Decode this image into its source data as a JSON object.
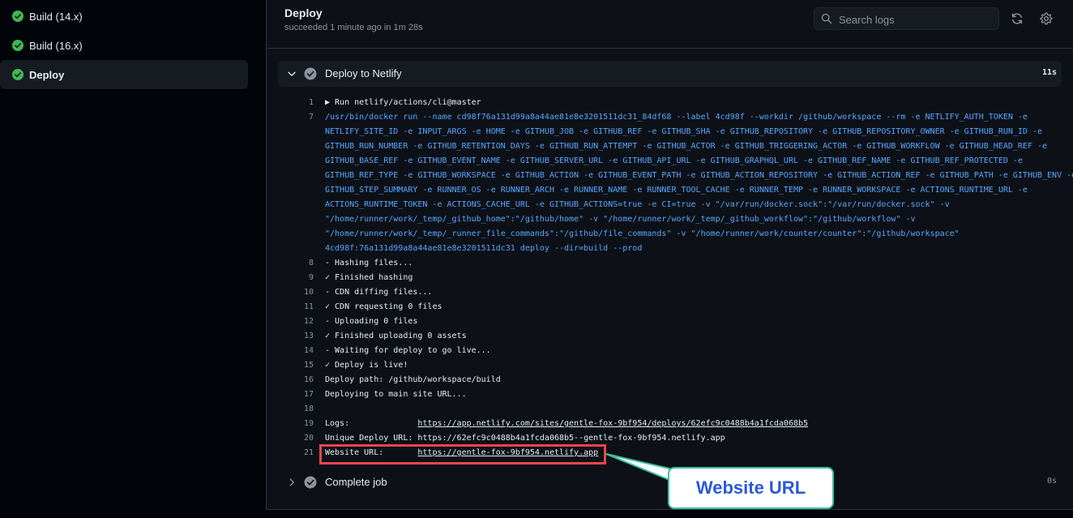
{
  "sidebar": {
    "jobs": [
      {
        "label": "Build (14.x)",
        "status": "success"
      },
      {
        "label": "Build (16.x)",
        "status": "success"
      },
      {
        "label": "Deploy",
        "status": "success",
        "active": true
      }
    ]
  },
  "header": {
    "title": "Deploy",
    "subtitle": "succeeded 1 minute ago in 1m 28s",
    "search_placeholder": "Search logs"
  },
  "steps": {
    "deploy": {
      "label": "Deploy to Netlify",
      "duration": "11s"
    },
    "complete": {
      "label": "Complete job",
      "duration": "0s"
    }
  },
  "log": [
    {
      "n": "1",
      "t": "▶ Run netlify/actions/cli@master"
    },
    {
      "n": "7",
      "t": "/usr/bin/docker run --name cd98f76a131d99a8a44ae81e8e3201511dc31_84df68 --label 4cd98f --workdir /github/workspace --rm -e NETLIFY_AUTH_TOKEN -e"
    },
    {
      "n": "",
      "t": "NETLIFY_SITE_ID -e INPUT_ARGS -e HOME -e GITHUB_JOB -e GITHUB_REF -e GITHUB_SHA -e GITHUB_REPOSITORY -e GITHUB_REPOSITORY_OWNER -e GITHUB_RUN_ID -e"
    },
    {
      "n": "",
      "t": "GITHUB_RUN_NUMBER -e GITHUB_RETENTION_DAYS -e GITHUB_RUN_ATTEMPT -e GITHUB_ACTOR -e GITHUB_TRIGGERING_ACTOR -e GITHUB_WORKFLOW -e GITHUB_HEAD_REF -e"
    },
    {
      "n": "",
      "t": "GITHUB_BASE_REF -e GITHUB_EVENT_NAME -e GITHUB_SERVER_URL -e GITHUB_API_URL -e GITHUB_GRAPHQL_URL -e GITHUB_REF_NAME -e GITHUB_REF_PROTECTED -e"
    },
    {
      "n": "",
      "t": "GITHUB_REF_TYPE -e GITHUB_WORKSPACE -e GITHUB_ACTION -e GITHUB_EVENT_PATH -e GITHUB_ACTION_REPOSITORY -e GITHUB_ACTION_REF -e GITHUB_PATH -e GITHUB_ENV -e"
    },
    {
      "n": "",
      "t": "GITHUB_STEP_SUMMARY -e RUNNER_OS -e RUNNER_ARCH -e RUNNER_NAME -e RUNNER_TOOL_CACHE -e RUNNER_TEMP -e RUNNER_WORKSPACE -e ACTIONS_RUNTIME_URL -e"
    },
    {
      "n": "",
      "t": "ACTIONS_RUNTIME_TOKEN -e ACTIONS_CACHE_URL -e GITHUB_ACTIONS=true -e CI=true -v \"/var/run/docker.sock\":\"/var/run/docker.sock\" -v"
    },
    {
      "n": "",
      "t": "\"/home/runner/work/_temp/_github_home\":\"/github/home\" -v \"/home/runner/work/_temp/_github_workflow\":\"/github/workflow\" -v"
    },
    {
      "n": "",
      "t": "\"/home/runner/work/_temp/_runner_file_commands\":\"/github/file_commands\" -v \"/home/runner/work/counter/counter\":\"/github/workspace\""
    },
    {
      "n": "",
      "t": "4cd98f:76a131d99a8a44ae81e8e3201511dc31 deploy --dir=build --prod"
    },
    {
      "n": "8",
      "t": "- Hashing files..."
    },
    {
      "n": "9",
      "t": "✓ Finished hashing"
    },
    {
      "n": "10",
      "t": "- CDN diffing files..."
    },
    {
      "n": "11",
      "t": "✓ CDN requesting 0 files"
    },
    {
      "n": "12",
      "t": "- Uploading 0 files"
    },
    {
      "n": "13",
      "t": "✓ Finished uploading 0 assets"
    },
    {
      "n": "14",
      "t": "- Waiting for deploy to go live..."
    },
    {
      "n": "15",
      "t": "✓ Deploy is live!"
    },
    {
      "n": "16",
      "t": "Deploy path: /github/workspace/build"
    },
    {
      "n": "17",
      "t": "Deploying to main site URL..."
    },
    {
      "n": "18",
      "t": ""
    },
    {
      "n": "19",
      "t": "Logs:              ",
      "link": "https://app.netlify.com/sites/gentle-fox-9bf954/deploys/62efc9c0488b4a1fcda068b5"
    },
    {
      "n": "20",
      "t": "Unique Deploy URL: https://62efc9c0488b4a1fcda068b5--gentle-fox-9bf954.netlify.app"
    },
    {
      "n": "21",
      "t": "Website URL:       ",
      "link": "https://gentle-fox-9bf954.netlify.app"
    }
  ],
  "annotation": {
    "label": "Website URL",
    "box_color": "#e8464b",
    "callout_border": "#3dbf9d",
    "callout_text_color": "#2b59d8"
  },
  "colors": {
    "success": "#3fb950",
    "command_blue": "#58a6ff",
    "step_check": "#8b949e"
  }
}
